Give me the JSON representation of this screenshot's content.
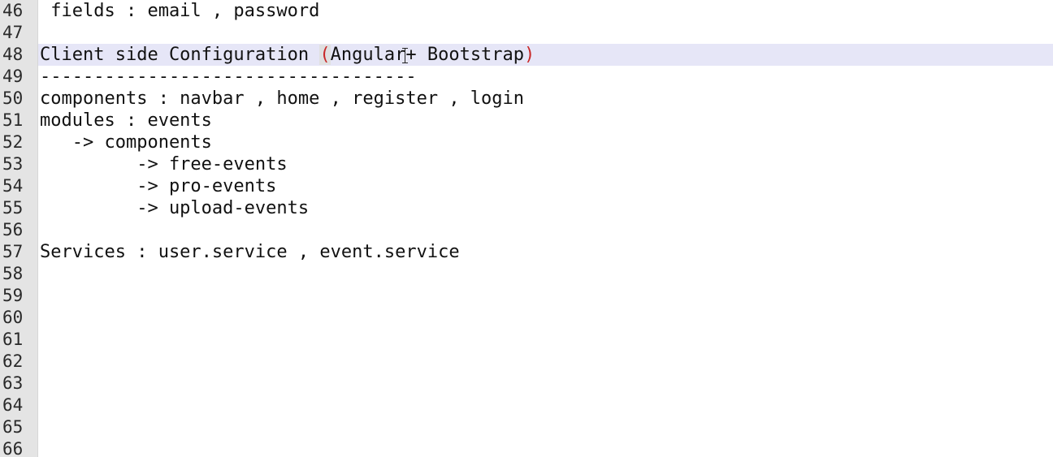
{
  "editor": {
    "line_numbers": [
      "46",
      "47",
      "48",
      "49",
      "50",
      "51",
      "52",
      "53",
      "54",
      "55",
      "56",
      "57",
      "58",
      "59",
      "60",
      "61",
      "62",
      "63",
      "64",
      "65",
      "66"
    ],
    "lines": {
      "l46": " fields : email , password",
      "l47": "",
      "l48_pre": "Client side Configuration ",
      "l48_open": "(",
      "l48_word1": "Angular",
      "l48_post": "+ Bootstrap",
      "l48_close": ")",
      "l49": "-----------------------------------",
      "l50": "components : navbar , home , register , login",
      "l51": "modules : events",
      "l52": "   -> components",
      "l53": "         -> free-events",
      "l54": "         -> pro-events",
      "l55": "         -> upload-events",
      "l56": "",
      "l57": "Services : user.service , event.service",
      "l58": "",
      "l59": "",
      "l60": "",
      "l61": "",
      "l62": "",
      "l63": "",
      "l64": "",
      "l65": "",
      "l66": ""
    },
    "colors": {
      "gutter_bg": "#e4e4e4",
      "current_line_bg": "#e6e6f7",
      "brace_match": "#c82828"
    },
    "icons": {
      "cursor": "i-beam-cursor-icon"
    }
  }
}
